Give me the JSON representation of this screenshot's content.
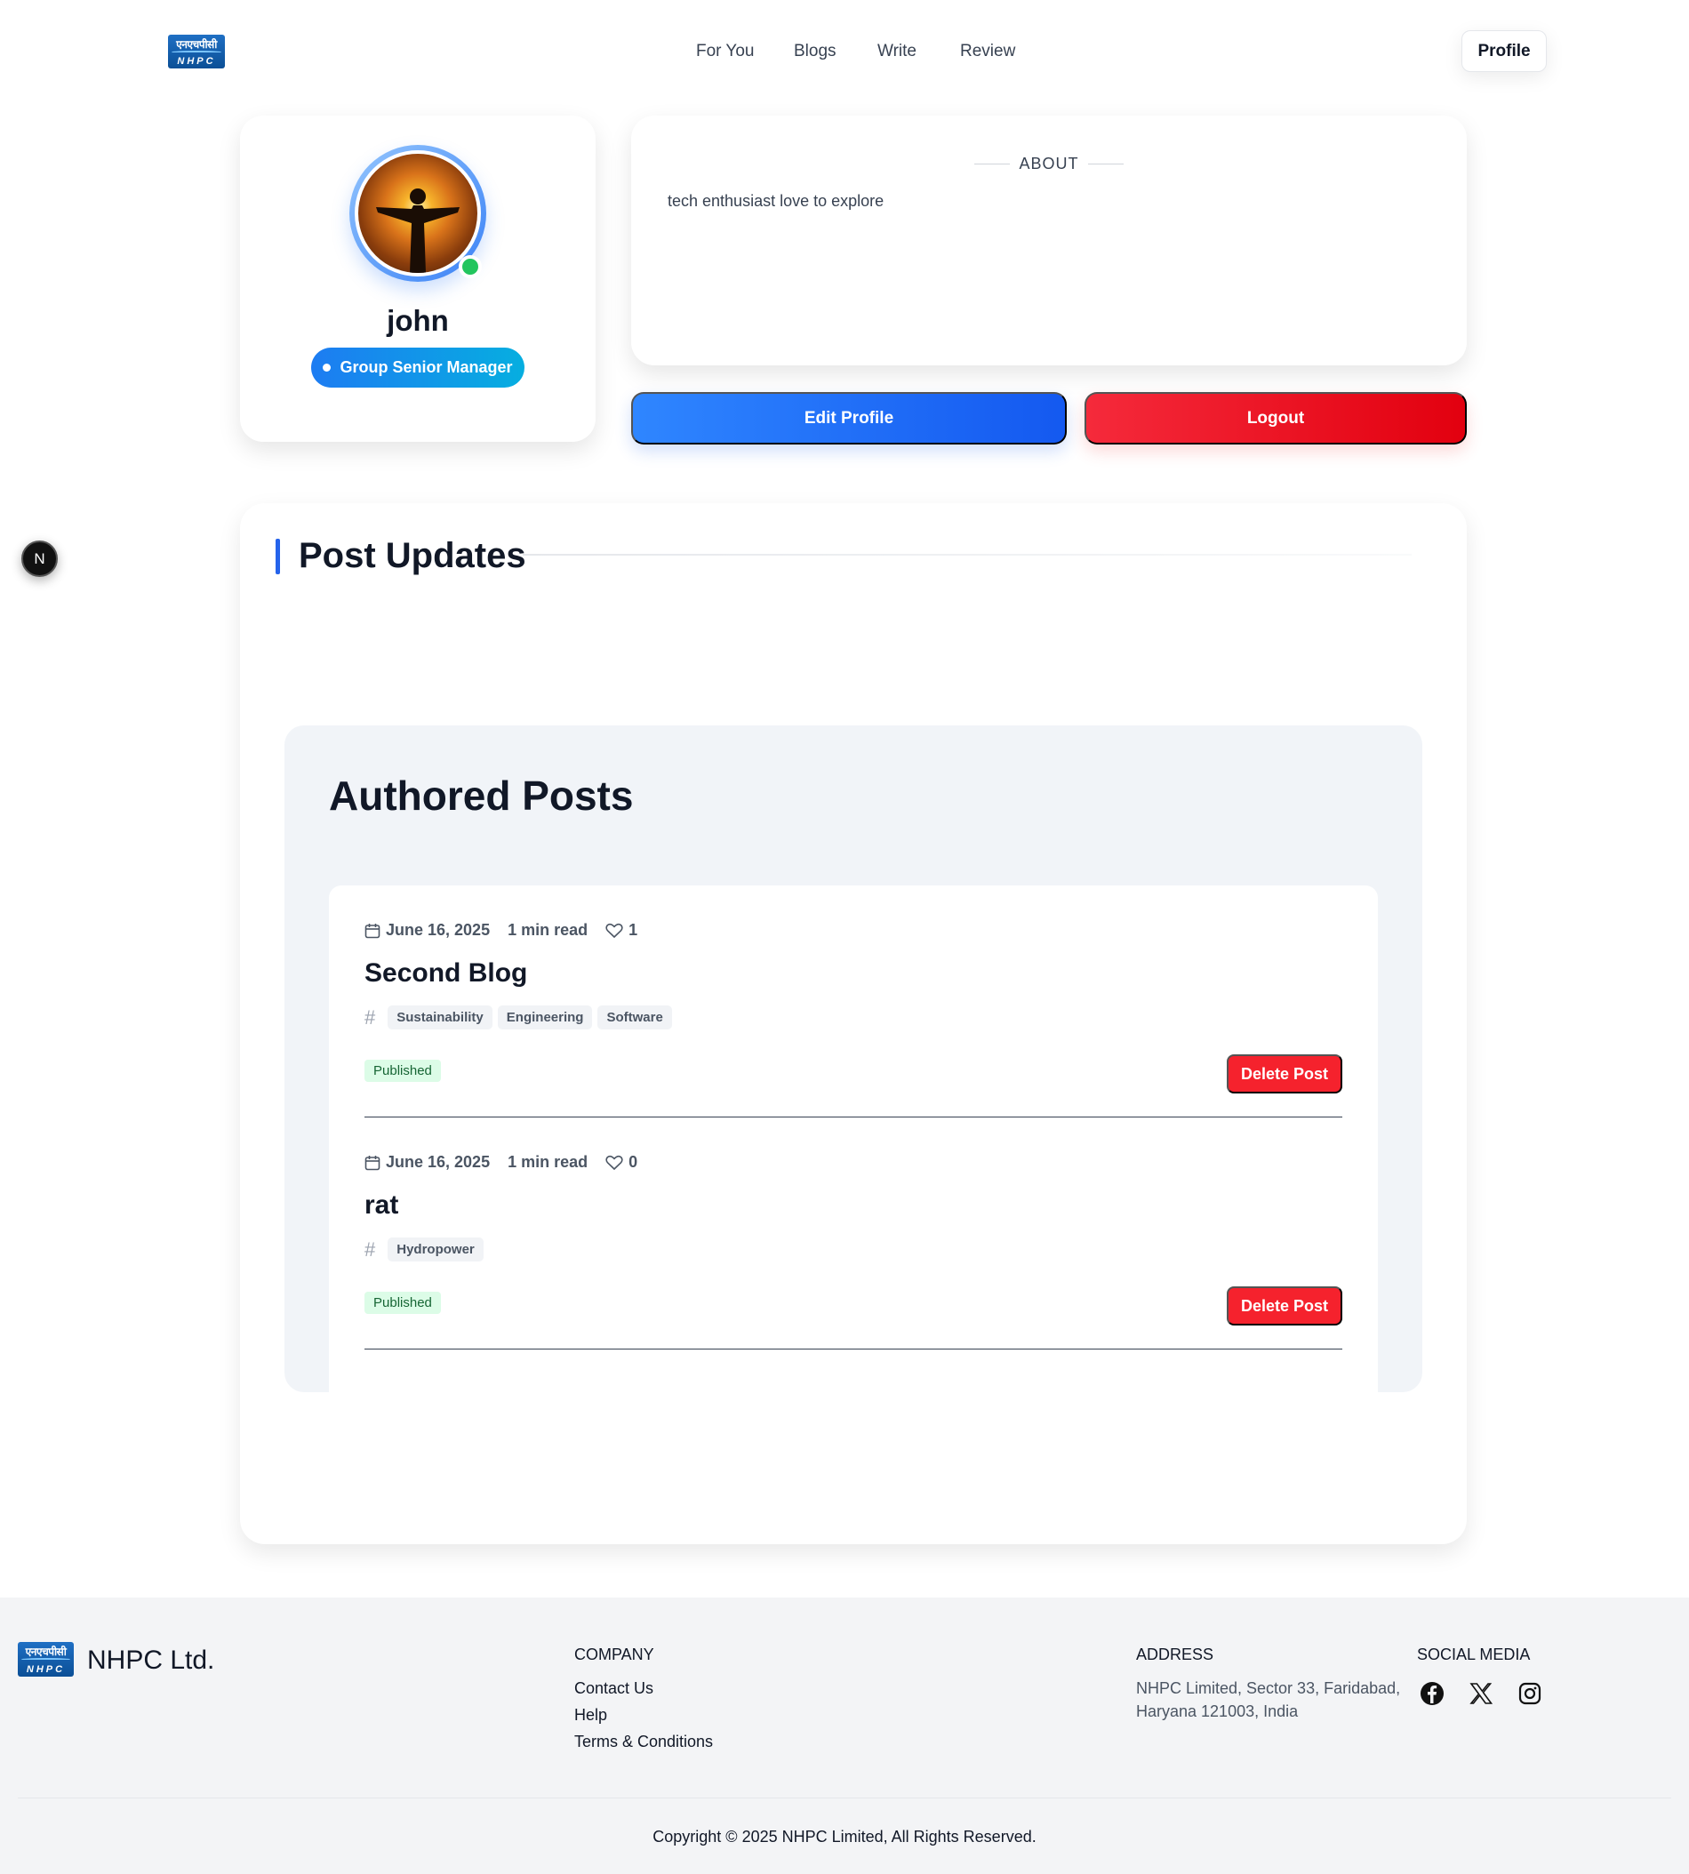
{
  "nav": {
    "logo_hindi": "एनएचपीसी",
    "logo_english": "NHPC",
    "links": [
      "For You",
      "Blogs",
      "Write",
      "Review"
    ],
    "profile_label": "Profile"
  },
  "profile": {
    "name": "john",
    "role": "Group Senior Manager",
    "about_heading": "ABOUT",
    "about_text": "tech enthusiast love to explore",
    "edit_label": "Edit Profile",
    "logout_label": "Logout"
  },
  "floating_badge": "N",
  "updates": {
    "title": "Post Updates",
    "authored_title": "Authored Posts",
    "posts": [
      {
        "date": "June 16, 2025",
        "read_time": "1 min read",
        "likes": "1",
        "title": "Second Blog",
        "tags": [
          "Sustainability",
          "Engineering",
          "Software"
        ],
        "status": "Published",
        "delete_label": "Delete Post"
      },
      {
        "date": "June 16, 2025",
        "read_time": "1 min read",
        "likes": "0",
        "title": "rat",
        "tags": [
          "Hydropower"
        ],
        "status": "Published",
        "delete_label": "Delete Post"
      }
    ]
  },
  "footer": {
    "brand": "NHPC Ltd.",
    "company_heading": "COMPANY",
    "company_links": [
      "Contact Us",
      "Help",
      "Terms & Conditions"
    ],
    "address_heading": "ADDRESS",
    "address": "NHPC Limited, Sector 33, Faridabad, Haryana 121003, India",
    "social_heading": "SOCIAL MEDIA",
    "social_icons": [
      "facebook-icon",
      "x-icon",
      "instagram-icon"
    ],
    "copyright": "Copyright © 2025 NHPC Limited, All Rights Reserved."
  },
  "colors": {
    "primary_blue": "#1d6ff2",
    "logout_red": "#ef1c2b",
    "delete_red": "#f5222d",
    "online_green": "#22c55e",
    "published_bg": "#dcfce7"
  }
}
